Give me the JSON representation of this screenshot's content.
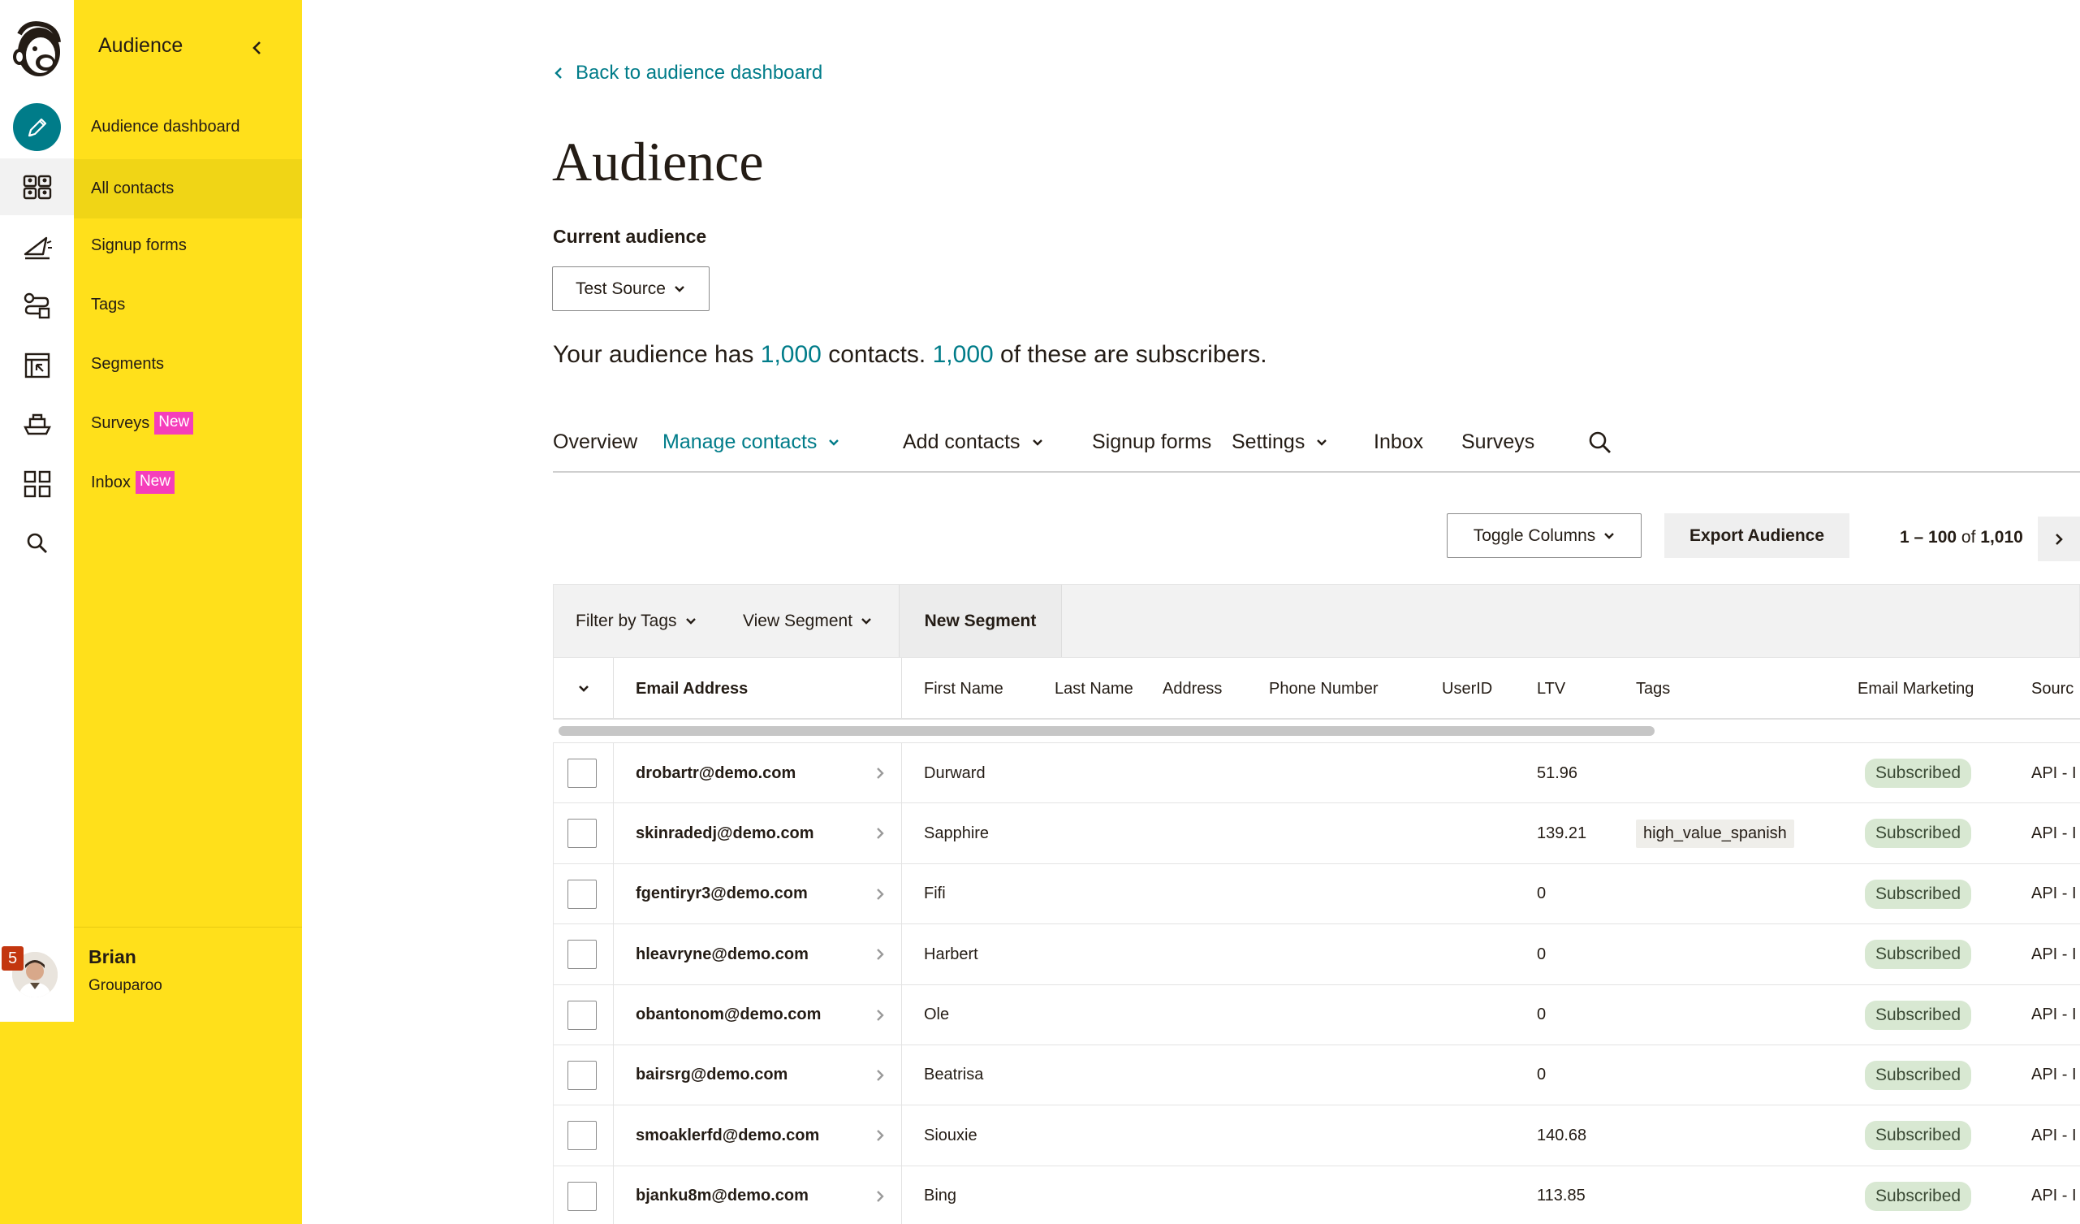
{
  "sidebar": {
    "title": "Audience",
    "items": [
      {
        "label": "Audience dashboard",
        "active": false
      },
      {
        "label": "All contacts",
        "active": true
      },
      {
        "label": "Signup forms",
        "active": false
      },
      {
        "label": "Tags",
        "active": false
      },
      {
        "label": "Segments",
        "active": false
      },
      {
        "label": "Surveys",
        "active": false,
        "badge": "New"
      },
      {
        "label": "Inbox",
        "active": false,
        "badge": "New"
      }
    ],
    "user": {
      "name": "Brian",
      "org": "Grouparoo",
      "notifications": "5"
    }
  },
  "rail": {
    "icons": [
      "freddie-logo-icon",
      "create-pencil-icon",
      "audience-icon",
      "campaigns-icon",
      "automations-icon",
      "website-icon",
      "content-icon",
      "integrations-icon",
      "search-icon"
    ]
  },
  "main": {
    "back_link": "Back to audience dashboard",
    "title": "Audience",
    "current_audience_label": "Current audience",
    "current_audience_value": "Test Source",
    "summary": {
      "prefix": "Your audience has",
      "contacts": "1,000",
      "middle": "contacts.",
      "subscribers": "1,000",
      "suffix": "of these are subscribers."
    },
    "tabs": [
      {
        "label": "Overview",
        "dropdown": false
      },
      {
        "label": "Manage contacts",
        "dropdown": true,
        "active": true
      },
      {
        "label": "Add contacts",
        "dropdown": true
      },
      {
        "label": "Signup forms",
        "dropdown": false
      },
      {
        "label": "Settings",
        "dropdown": true
      },
      {
        "label": "Inbox",
        "dropdown": false
      },
      {
        "label": "Surveys",
        "dropdown": false
      }
    ],
    "toolbar": {
      "toggle_columns": "Toggle Columns",
      "export": "Export Audience",
      "pager_range": "1 – 100",
      "pager_of": "of",
      "pager_total": "1,010"
    },
    "filters": {
      "filter_by_tags": "Filter by Tags",
      "view_segment": "View Segment",
      "new_segment": "New Segment"
    },
    "table": {
      "columns": [
        "Email Address",
        "First Name",
        "Last Name",
        "Address",
        "Phone Number",
        "UserID",
        "LTV",
        "Tags",
        "Email Marketing",
        "Sourc"
      ],
      "rows": [
        {
          "email": "drobartr@demo.com",
          "first": "Durward",
          "ltv": "51.96",
          "tag": "",
          "status": "Subscribed",
          "source": "API - I"
        },
        {
          "email": "skinradedj@demo.com",
          "first": "Sapphire",
          "ltv": "139.21",
          "tag": "high_value_spanish",
          "status": "Subscribed",
          "source": "API - I"
        },
        {
          "email": "fgentiryr3@demo.com",
          "first": "Fifi",
          "ltv": "0",
          "tag": "",
          "status": "Subscribed",
          "source": "API - I"
        },
        {
          "email": "hleavryne@demo.com",
          "first": "Harbert",
          "ltv": "0",
          "tag": "",
          "status": "Subscribed",
          "source": "API - I"
        },
        {
          "email": "obantonom@demo.com",
          "first": "Ole",
          "ltv": "0",
          "tag": "",
          "status": "Subscribed",
          "source": "API - I"
        },
        {
          "email": "bairsrg@demo.com",
          "first": "Beatrisa",
          "ltv": "0",
          "tag": "",
          "status": "Subscribed",
          "source": "API - I"
        },
        {
          "email": "smoaklerfd@demo.com",
          "first": "Siouxie",
          "ltv": "140.68",
          "tag": "",
          "status": "Subscribed",
          "source": "API - I"
        },
        {
          "email": "bjanku8m@demo.com",
          "first": "Bing",
          "ltv": "113.85",
          "tag": "",
          "status": "Subscribed",
          "source": "API - I"
        }
      ]
    }
  },
  "colors": {
    "brand_yellow": "#ffe01b",
    "accent_teal": "#007c89",
    "new_badge": "#f53ebb",
    "subscribed_bg": "#d8e8d2"
  }
}
